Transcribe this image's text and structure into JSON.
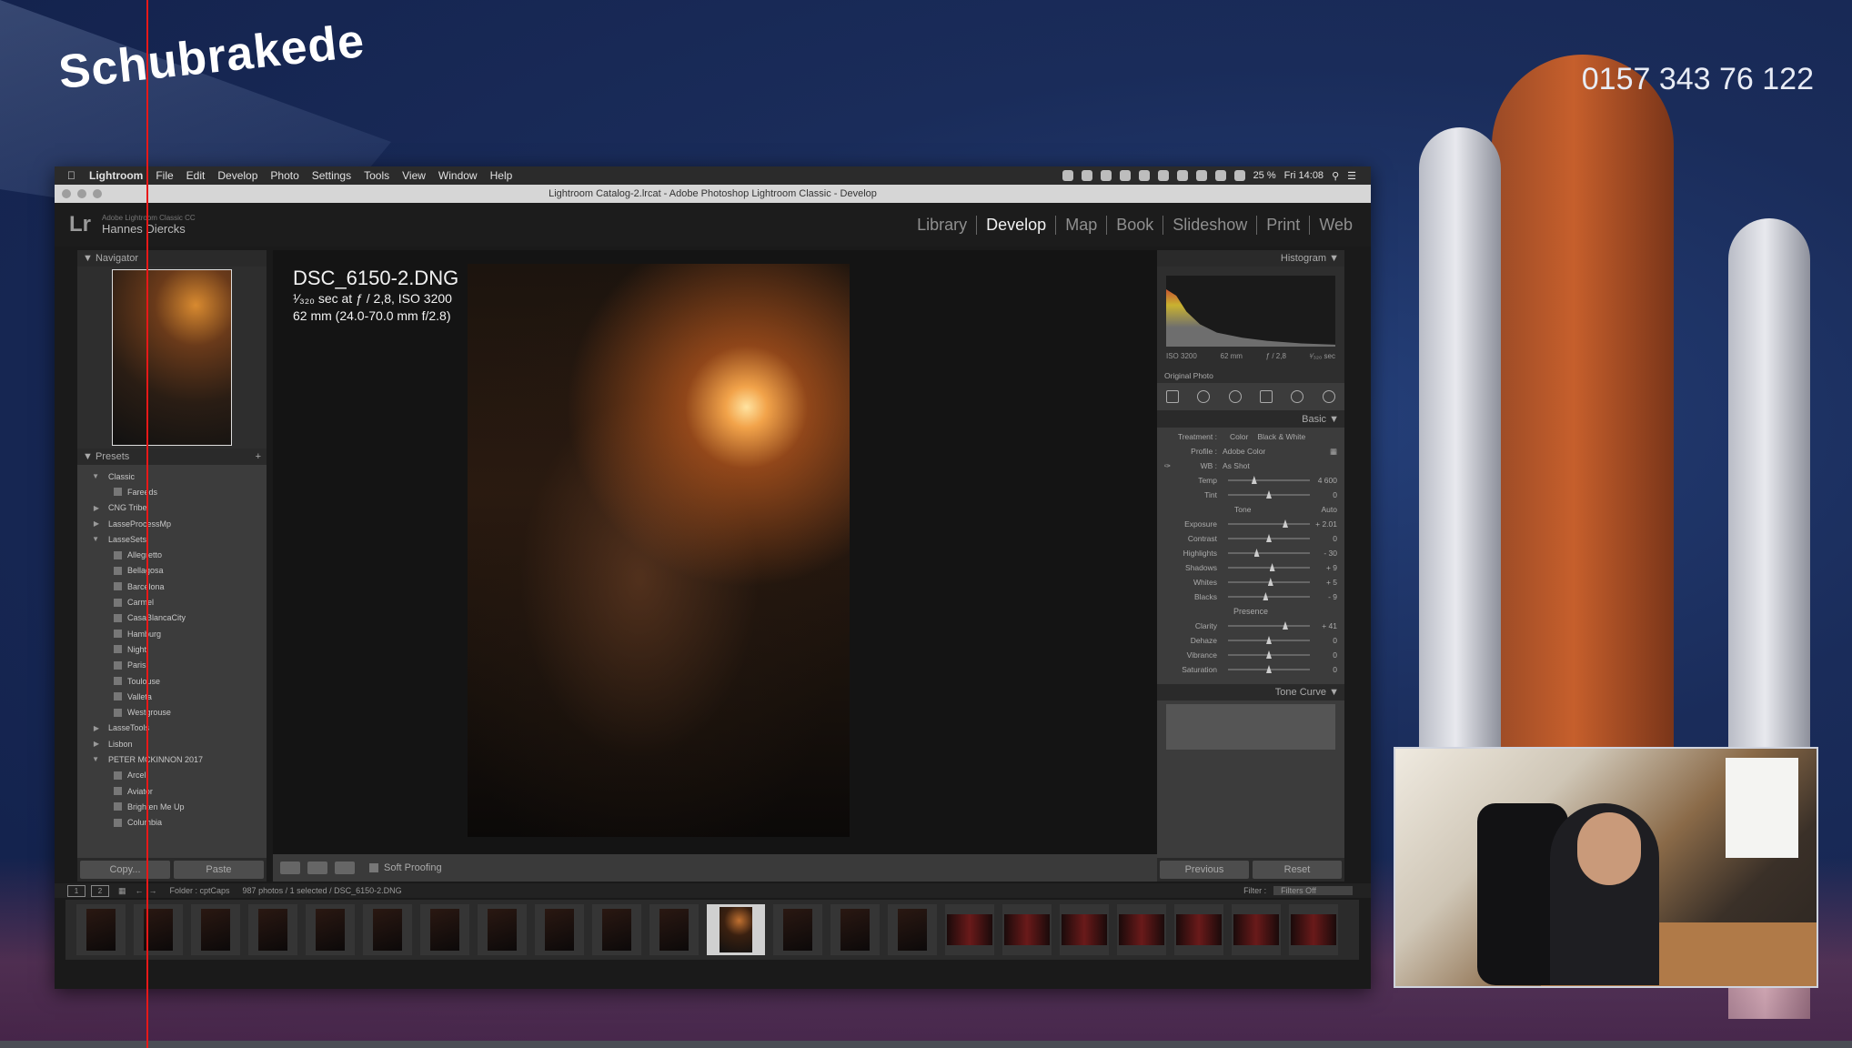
{
  "brand": "Schubrakede",
  "phone": "0157 343 76 122",
  "menubar": {
    "items": [
      "Lightroom",
      "File",
      "Edit",
      "Develop",
      "Photo",
      "Settings",
      "Tools",
      "View",
      "Window",
      "Help"
    ],
    "status": "25 %",
    "clock": "Fri 14:08"
  },
  "window_title": "Lightroom Catalog-2.lrcat - Adobe Photoshop Lightroom Classic - Develop",
  "identity": {
    "sub": "Adobe Lightroom Classic CC",
    "name": "Hannes Diercks"
  },
  "modules": [
    "Library",
    "Develop",
    "Map",
    "Book",
    "Slideshow",
    "Print",
    "Web"
  ],
  "active_module": "Develop",
  "navigator": {
    "label": "Navigator"
  },
  "presets": {
    "label": "Presets",
    "items": [
      {
        "type": "group",
        "label": "Classic",
        "open": true
      },
      {
        "type": "item",
        "label": "Fareeds"
      },
      {
        "type": "group",
        "label": "CNG Tribe",
        "open": false
      },
      {
        "type": "group",
        "label": "LasseProcessMp",
        "open": false
      },
      {
        "type": "group",
        "label": "LasseSets",
        "open": true
      },
      {
        "type": "item",
        "label": "Allegretto"
      },
      {
        "type": "item",
        "label": "Bellagosa"
      },
      {
        "type": "item",
        "label": "Barcelona"
      },
      {
        "type": "item",
        "label": "Carmel"
      },
      {
        "type": "item",
        "label": "CasaBlancaCity"
      },
      {
        "type": "item",
        "label": "Hamburg"
      },
      {
        "type": "item",
        "label": "Night"
      },
      {
        "type": "item",
        "label": "Paris"
      },
      {
        "type": "item",
        "label": "Toulouse"
      },
      {
        "type": "item",
        "label": "Valleta"
      },
      {
        "type": "item",
        "label": "Westgrouse"
      },
      {
        "type": "group",
        "label": "LasseTools",
        "open": false
      },
      {
        "type": "group",
        "label": "Lisbon",
        "open": false
      },
      {
        "type": "group",
        "label": "PETER MCKINNON 2017",
        "open": true
      },
      {
        "type": "item",
        "label": "Arcel"
      },
      {
        "type": "item",
        "label": "Aviator"
      },
      {
        "type": "item",
        "label": "Brighten Me Up"
      },
      {
        "type": "item",
        "label": "Columbia"
      }
    ]
  },
  "left_buttons": {
    "copy": "Copy...",
    "paste": "Paste"
  },
  "photo_info": {
    "filename": "DSC_6150-2.DNG",
    "exposure": "¹⁄₃₂₀ sec at ƒ / 2,8, ISO 3200",
    "lens": "62 mm (24.0-70.0 mm f/2.8)"
  },
  "toolbar": {
    "soft_proofing": "Soft Proofing"
  },
  "histogram": {
    "label": "Histogram",
    "meta": [
      "ISO 3200",
      "62 mm",
      "ƒ / 2,8",
      "¹⁄₃₂₀ sec"
    ],
    "original_photo": "Original Photo"
  },
  "basic": {
    "label": "Basic",
    "treatment_label": "Treatment :",
    "treatment_color": "Color",
    "treatment_bw": "Black & White",
    "profile_label": "Profile :",
    "profile_value": "Adobe Color",
    "wb_label": "WB :",
    "wb_value": "As Shot",
    "tone_label": "Tone",
    "tone_auto": "Auto",
    "presence_label": "Presence",
    "sliders": [
      {
        "label": "Temp",
        "value": "4 600",
        "pos": 0.32
      },
      {
        "label": "Tint",
        "value": "0",
        "pos": 0.5
      },
      {
        "label": "Exposure",
        "value": "+ 2.01",
        "pos": 0.7
      },
      {
        "label": "Contrast",
        "value": "0",
        "pos": 0.5
      },
      {
        "label": "Highlights",
        "value": "- 30",
        "pos": 0.35
      },
      {
        "label": "Shadows",
        "value": "+ 9",
        "pos": 0.54
      },
      {
        "label": "Whites",
        "value": "+ 5",
        "pos": 0.52
      },
      {
        "label": "Blacks",
        "value": "- 9",
        "pos": 0.46
      },
      {
        "label": "Clarity",
        "value": "+ 41",
        "pos": 0.7
      },
      {
        "label": "Dehaze",
        "value": "0",
        "pos": 0.5
      },
      {
        "label": "Vibrance",
        "value": "0",
        "pos": 0.5
      },
      {
        "label": "Saturation",
        "value": "0",
        "pos": 0.5
      }
    ]
  },
  "tone_curve": {
    "label": "Tone Curve"
  },
  "right_buttons": {
    "previous": "Previous",
    "reset": "Reset"
  },
  "filmbar": {
    "page1": "1",
    "page2": "2",
    "folder": "Folder : cptCaps",
    "count": "987 photos / 1 selected / DSC_6150-2.DNG",
    "filter_label": "Filter :",
    "filter_value": "Filters Off"
  },
  "filmstrip": {
    "count": 22,
    "selected_index": 11,
    "landscape_from": 15
  }
}
